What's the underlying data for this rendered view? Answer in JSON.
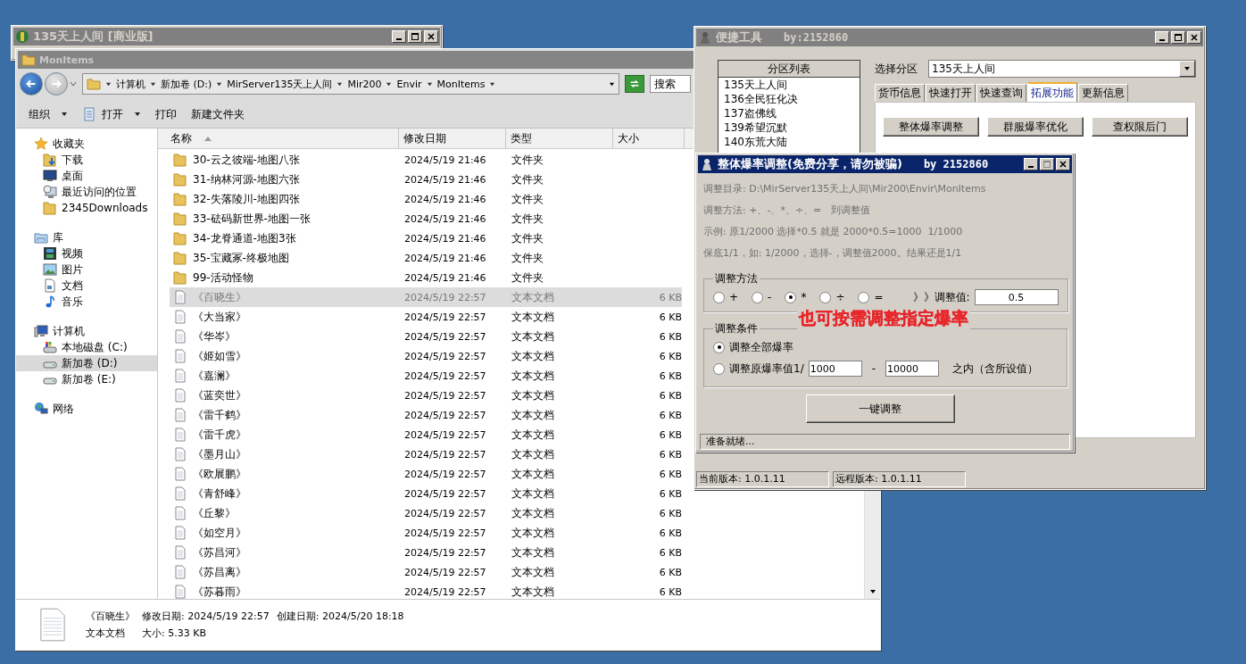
{
  "back_window": {
    "title": "135天上人间 [商业版]"
  },
  "explorer": {
    "title": "MonItems",
    "breadcrumb": [
      "计算机",
      "新加卷 (D:)",
      "MirServer135天上人间",
      "Mir200",
      "Envir",
      "MonItems"
    ],
    "search": {
      "placeholder": "搜索"
    },
    "toolbar": [
      {
        "label": "组织",
        "icon": false,
        "dropdown": true
      },
      {
        "label": "打开",
        "icon": true,
        "dropdown": true
      },
      {
        "label": "打印",
        "icon": false,
        "dropdown": false
      },
      {
        "label": "新建文件夹",
        "icon": false,
        "dropdown": false
      }
    ],
    "sidebar": [
      {
        "label": "收藏夹",
        "kind": "star",
        "children": [
          {
            "label": "下载",
            "kind": "download",
            "selected": false
          },
          {
            "label": "桌面",
            "kind": "desktop",
            "selected": false
          },
          {
            "label": "最近访问的位置",
            "kind": "recent",
            "selected": false
          },
          {
            "label": "2345Downloads",
            "kind": "folder",
            "selected": false
          }
        ]
      },
      {
        "label": "库",
        "kind": "library",
        "children": [
          {
            "label": "视频",
            "kind": "video",
            "selected": false
          },
          {
            "label": "图片",
            "kind": "picture",
            "selected": false
          },
          {
            "label": "文档",
            "kind": "document",
            "selected": false
          },
          {
            "label": "音乐",
            "kind": "music",
            "selected": false
          }
        ]
      },
      {
        "label": "计算机",
        "kind": "computer",
        "children": [
          {
            "label": "本地磁盘 (C:)",
            "kind": "system-drive",
            "selected": false
          },
          {
            "label": "新加卷 (D:)",
            "kind": "drive",
            "selected": true
          },
          {
            "label": "新加卷 (E:)",
            "kind": "drive",
            "selected": false
          }
        ]
      },
      {
        "label": "网络",
        "kind": "network"
      }
    ],
    "columns": [
      {
        "label": "名称",
        "sorted": true
      },
      {
        "label": "修改日期",
        "sorted": false
      },
      {
        "label": "类型",
        "sorted": false
      },
      {
        "label": "大小",
        "sorted": false
      }
    ],
    "rows": [
      {
        "name": "30-云之彼端-地图八张",
        "date": "2024/5/19 21:46",
        "type": "文件夹",
        "kind": "folder",
        "selected": false
      },
      {
        "name": "31-纳林河源-地图六张",
        "date": "2024/5/19 21:46",
        "type": "文件夹",
        "kind": "folder",
        "selected": false
      },
      {
        "name": "32-失落陵川-地图四张",
        "date": "2024/5/19 21:46",
        "type": "文件夹",
        "kind": "folder",
        "selected": false
      },
      {
        "name": "33-砝码新世界-地图一张",
        "date": "2024/5/19 21:46",
        "type": "文件夹",
        "kind": "folder",
        "selected": false
      },
      {
        "name": "34-龙脊通道-地图3张",
        "date": "2024/5/19 21:46",
        "type": "文件夹",
        "kind": "folder",
        "selected": false
      },
      {
        "name": "35-宝藏冢-终极地图",
        "date": "2024/5/19 21:46",
        "type": "文件夹",
        "kind": "folder",
        "selected": false
      },
      {
        "name": "99-活动怪物",
        "date": "2024/5/19 21:46",
        "type": "文件夹",
        "kind": "folder",
        "selected": false
      },
      {
        "name": "《百晓生》",
        "date": "2024/5/19 22:57",
        "type": "文本文档",
        "size": "6 KB",
        "kind": "file",
        "selected": true
      },
      {
        "name": "《大当家》",
        "date": "2024/5/19 22:57",
        "type": "文本文档",
        "size": "6 KB",
        "kind": "file",
        "selected": false
      },
      {
        "name": "《华岑》",
        "date": "2024/5/19 22:57",
        "type": "文本文档",
        "size": "6 KB",
        "kind": "file",
        "selected": false
      },
      {
        "name": "《姬如雪》",
        "date": "2024/5/19 22:57",
        "type": "文本文档",
        "size": "6 KB",
        "kind": "file",
        "selected": false
      },
      {
        "name": "《嘉澜》",
        "date": "2024/5/19 22:57",
        "type": "文本文档",
        "size": "6 KB",
        "kind": "file",
        "selected": false
      },
      {
        "name": "《蓝奕世》",
        "date": "2024/5/19 22:57",
        "type": "文本文档",
        "size": "6 KB",
        "kind": "file",
        "selected": false
      },
      {
        "name": "《雷千鹤》",
        "date": "2024/5/19 22:57",
        "type": "文本文档",
        "size": "6 KB",
        "kind": "file",
        "selected": false
      },
      {
        "name": "《雷千虎》",
        "date": "2024/5/19 22:57",
        "type": "文本文档",
        "size": "6 KB",
        "kind": "file",
        "selected": false
      },
      {
        "name": "《墨月山》",
        "date": "2024/5/19 22:57",
        "type": "文本文档",
        "size": "6 KB",
        "kind": "file",
        "selected": false
      },
      {
        "name": "《欧展鹏》",
        "date": "2024/5/19 22:57",
        "type": "文本文档",
        "size": "6 KB",
        "kind": "file",
        "selected": false
      },
      {
        "name": "《青舒峰》",
        "date": "2024/5/19 22:57",
        "type": "文本文档",
        "size": "6 KB",
        "kind": "file",
        "selected": false
      },
      {
        "name": "《丘黎》",
        "date": "2024/5/19 22:57",
        "type": "文本文档",
        "size": "6 KB",
        "kind": "file",
        "selected": false
      },
      {
        "name": "《如空月》",
        "date": "2024/5/19 22:57",
        "type": "文本文档",
        "size": "6 KB",
        "kind": "file",
        "selected": false
      },
      {
        "name": "《苏昌河》",
        "date": "2024/5/19 22:57",
        "type": "文本文档",
        "size": "6 KB",
        "kind": "file",
        "selected": false
      },
      {
        "name": "《苏昌离》",
        "date": "2024/5/19 22:57",
        "type": "文本文档",
        "size": "6 KB",
        "kind": "file",
        "selected": false
      },
      {
        "name": "《苏暮雨》",
        "date": "2024/5/19 22:57",
        "type": "文本文档",
        "size": "6 KB",
        "kind": "file",
        "selected": false
      }
    ],
    "details": {
      "name": "《百晓生》",
      "type": "文本文档",
      "modified": "修改日期: 2024/5/19 22:57",
      "created": "创建日期: 2024/5/20 18:18",
      "size": "大小: 5.33 KB"
    }
  },
  "tool_window": {
    "title": "便捷工具",
    "author": "by:2152860",
    "partition_list": {
      "header": "分区列表",
      "items": [
        "135天上人间",
        "136全民狂化决",
        "137盗佛线",
        "139希望沉默",
        "140东荒大陆"
      ]
    },
    "select": {
      "label": "选择分区",
      "value": "135天上人间"
    },
    "tabs": [
      {
        "label": "货币信息",
        "selected": false
      },
      {
        "label": "快速打开",
        "selected": false
      },
      {
        "label": "快速查询",
        "selected": false
      },
      {
        "label": "拓展功能",
        "selected": true
      },
      {
        "label": "更新信息",
        "selected": false
      }
    ],
    "buttons": [
      "整体爆率调整",
      "群服爆率优化",
      "查权限后门"
    ],
    "status_bar": [
      "当前版本: 1.0.1.11",
      "远程版本: 1.0.1.11"
    ]
  },
  "dialog": {
    "title": "整体爆率调整(免费分享，请勿被骗)",
    "author": "by 2152860",
    "info": [
      "调整目录: D:\\MirServer135天上人间\\Mir200\\Envir\\MonItems",
      "调整方法: +、-、*、÷、=   到调整值",
      "示例: 原1/2000 选择*0.5 就是 2000*0.5=1000  1/1000",
      "保底1/1，如: 1/2000，选择-，调整值2000。结果还是1/1"
    ],
    "method_group": {
      "title": "调整方法",
      "options": [
        {
          "label": "+",
          "selected": false
        },
        {
          "label": "-",
          "selected": false
        },
        {
          "label": "*",
          "selected": true
        },
        {
          "label": "÷",
          "selected": false
        },
        {
          "label": "=",
          "selected": false
        }
      ],
      "value_label": "》》调整值:",
      "value": "0.5"
    },
    "condition_group": {
      "title": "调整条件",
      "options": [
        {
          "kind": "plain",
          "label": "调整全部爆率",
          "selected": true
        },
        {
          "kind": "range",
          "label": "调整原爆率值1/",
          "selected": false,
          "from": "1000",
          "dash": "-",
          "to": "10000",
          "suffix": "之内（含所设值）"
        }
      ]
    },
    "button": "一键调整",
    "status": "准备就绪..."
  },
  "annotation": "也可按需调整指定爆率"
}
